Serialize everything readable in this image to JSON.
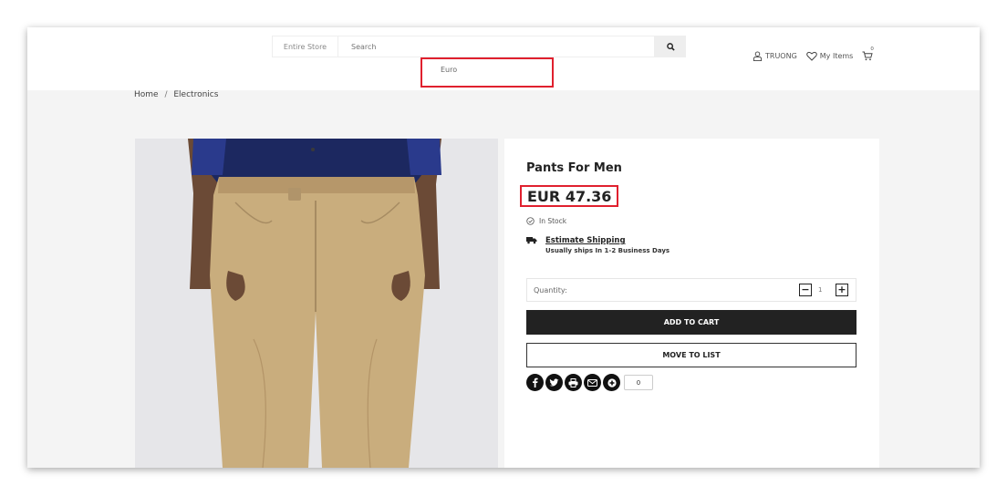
{
  "header": {
    "scope_label": "Entire Store",
    "search_placeholder": "Search",
    "currency_option": "Euro",
    "account_label": "TRUONG",
    "wishlist_label": "My Items",
    "cart_count": "0"
  },
  "breadcrumb": {
    "home": "Home",
    "separator": "/",
    "current": "Electronics"
  },
  "product": {
    "title": "Pants For Men",
    "price": "EUR 47.36",
    "stock": "In Stock",
    "shipping_link": "Estimate Shipping",
    "shipping_note": "Usually ships In 1-2 Business Days",
    "quantity_label": "Quantity:",
    "quantity_value": "1",
    "add_to_cart": "ADD TO CART",
    "move_to_list": "MOVE TO LIST",
    "share_count": "0"
  },
  "icons": [
    "user-icon",
    "heart-icon",
    "cart-icon",
    "search-icon",
    "check-circle-icon",
    "truck-icon",
    "facebook-icon",
    "twitter-icon",
    "print-icon",
    "email-icon",
    "plus-share-icon"
  ],
  "colors": {
    "highlight": "#e0202e",
    "primary_button": "#222222",
    "page_bg": "#f4f4f4"
  }
}
